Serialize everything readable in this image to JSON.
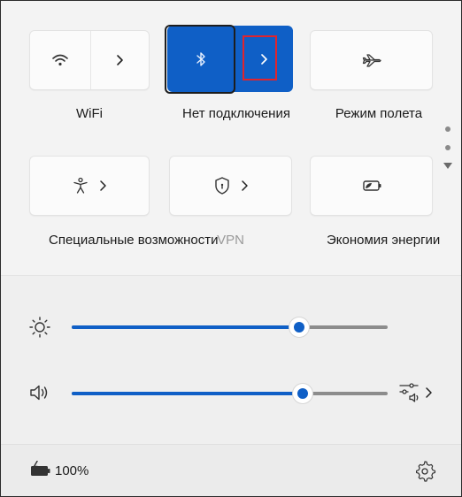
{
  "tiles": {
    "wifi": {
      "label": "WiFi",
      "icon": "wifi-icon",
      "chevron": "chevron-right-icon"
    },
    "bluetooth": {
      "label": "Нет подключения",
      "icon": "bluetooth-icon",
      "chevron": "chevron-right-icon",
      "active": true
    },
    "airplane": {
      "label": "Режим полета",
      "icon": "airplane-icon"
    },
    "accessibility": {
      "label": "Специальные возможности",
      "icon": "accessibility-icon",
      "chevron": "chevron-right-icon"
    },
    "vpn": {
      "label": "VPN",
      "icon": "shield-icon",
      "chevron": "chevron-right-icon"
    },
    "energy_saver": {
      "label": "Экономия энергии",
      "icon": "battery-saver-icon"
    }
  },
  "sliders": {
    "brightness": {
      "icon": "brightness-icon",
      "value": 0.72
    },
    "volume": {
      "icon": "speaker-icon",
      "value": 0.73,
      "extra_icon": "audio-output-icon"
    }
  },
  "footer": {
    "battery_icon": "battery-charging-icon",
    "battery_text": "100%",
    "settings_icon": "gear-icon"
  },
  "colors": {
    "accent": "#0f5fc6",
    "highlight": "#e0242d",
    "panel": "#f3f3f3"
  }
}
